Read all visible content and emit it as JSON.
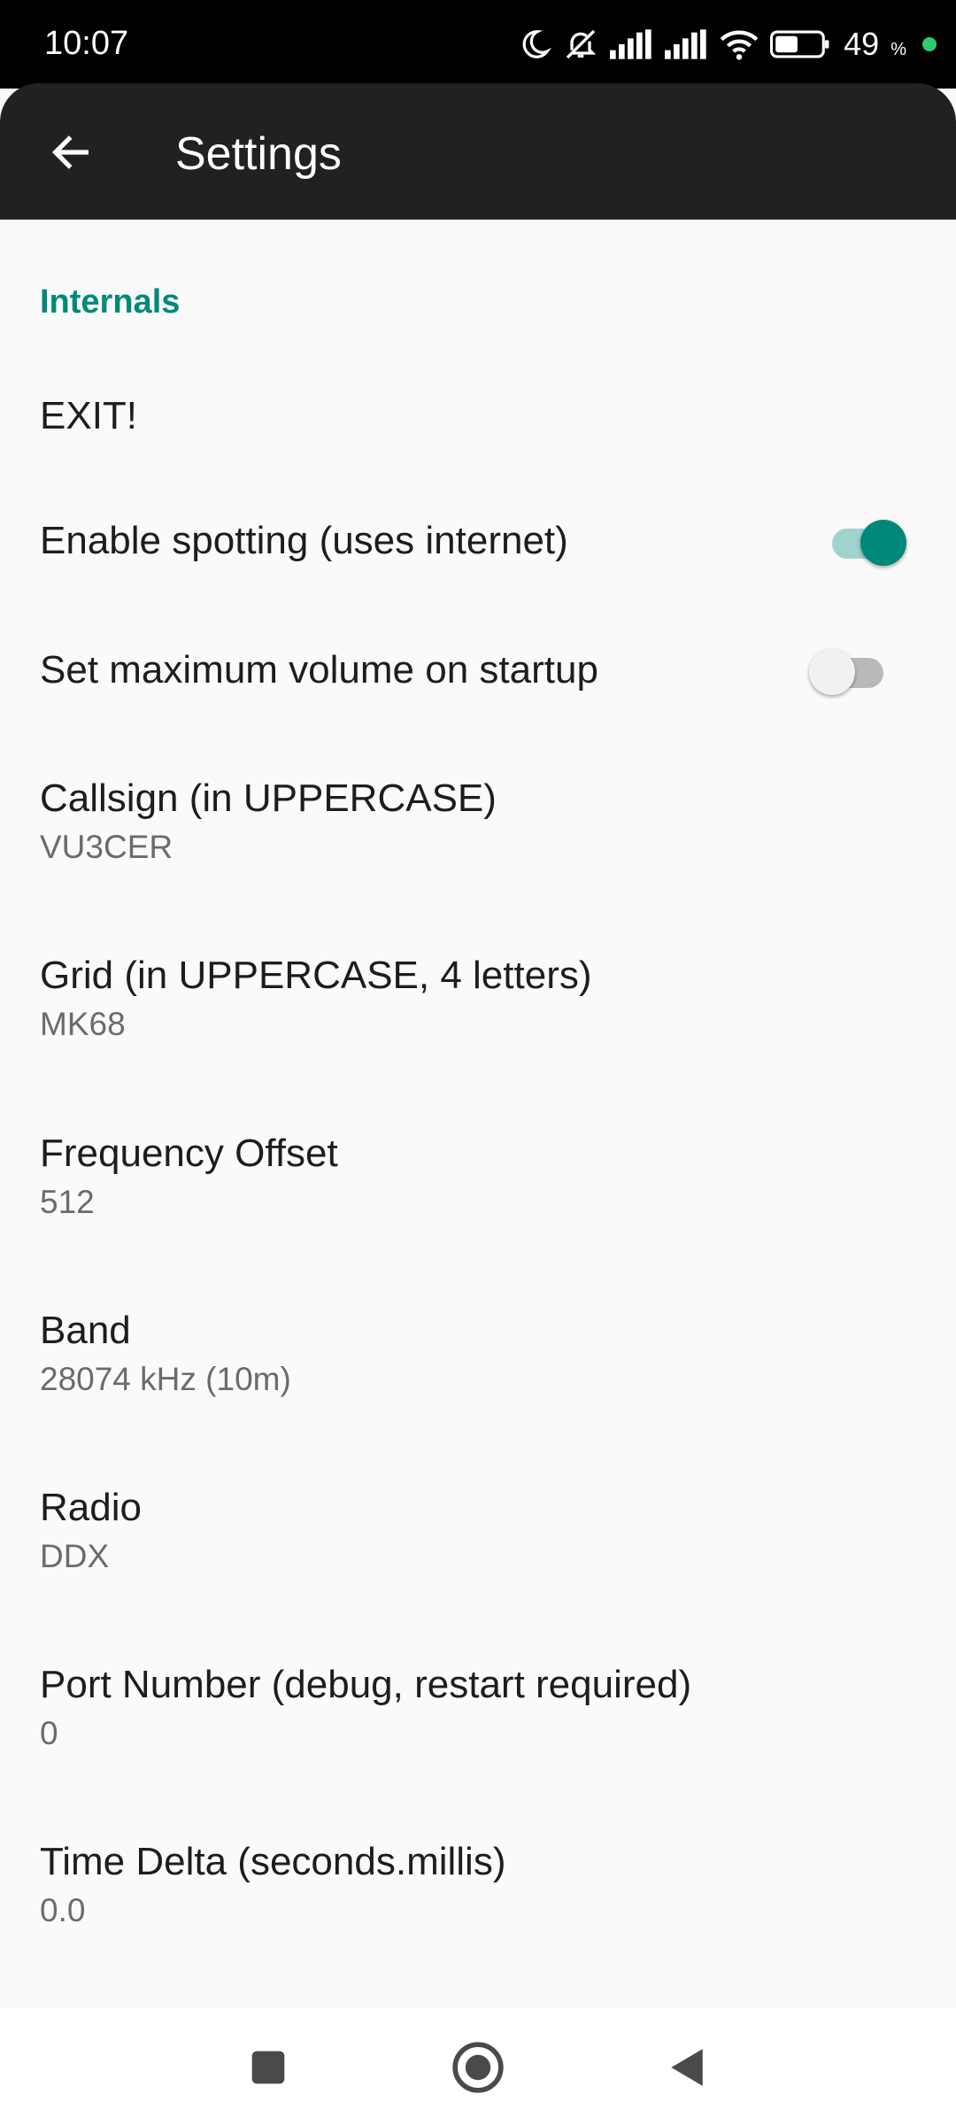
{
  "status_bar": {
    "time": "10:07",
    "battery_level": "49",
    "battery_unit": "%",
    "icons": [
      "moon-icon",
      "mute-icon",
      "signal-icon",
      "signal-icon",
      "wifi-icon",
      "battery-icon"
    ]
  },
  "app_bar": {
    "title": "Settings",
    "back_icon": "arrow-left-icon"
  },
  "category": {
    "title": "Internals"
  },
  "prefs": {
    "exit": {
      "title": "EXIT!"
    },
    "spotting": {
      "title": "Enable spotting (uses internet)",
      "checked": true
    },
    "max_volume": {
      "title": "Set maximum volume on startup",
      "checked": false
    },
    "callsign": {
      "title": "Callsign (in UPPERCASE)",
      "summary": "VU3CER"
    },
    "grid": {
      "title": "Grid (in UPPERCASE, 4 letters)",
      "summary": "MK68"
    },
    "freq_offset": {
      "title": "Frequency Offset",
      "summary": "512"
    },
    "band": {
      "title": "Band",
      "summary": "28074 kHz (10m)"
    },
    "radio": {
      "title": "Radio",
      "summary": "DDX"
    },
    "port": {
      "title": "Port Number (debug, restart required)",
      "summary": "0"
    },
    "time_delta": {
      "title": "Time Delta (seconds.millis)",
      "summary": "0.0"
    }
  },
  "nav_bar": {
    "buttons": [
      "recents-icon",
      "home-icon",
      "back-icon"
    ]
  },
  "colors": {
    "accent": "#00897b",
    "app_bar": "#212121",
    "background": "#fafafa"
  }
}
